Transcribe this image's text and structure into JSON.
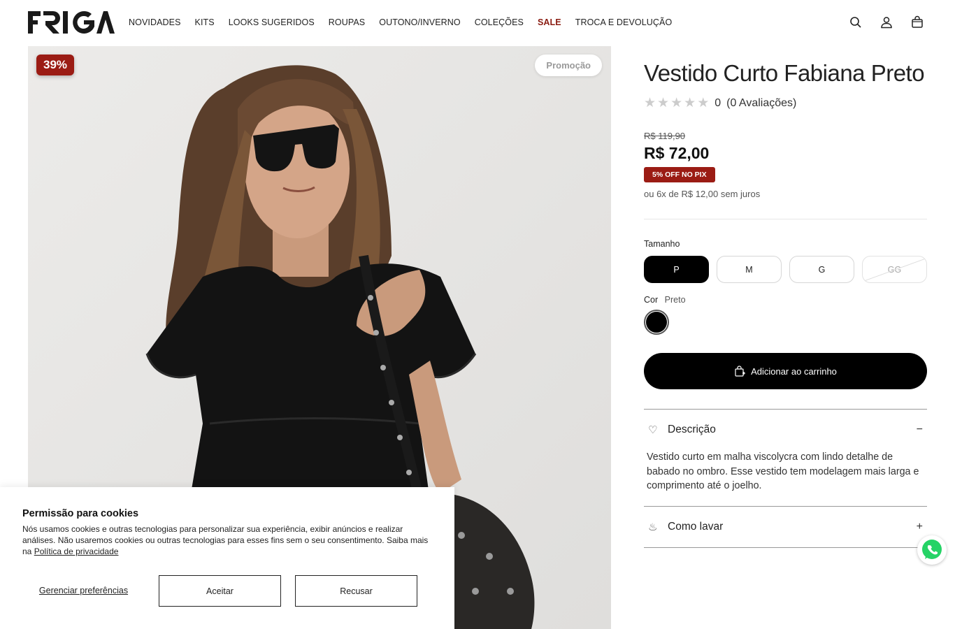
{
  "header": {
    "logo_text": "FRIGA",
    "nav": [
      {
        "label": "NOVIDADES"
      },
      {
        "label": "KITS"
      },
      {
        "label": "LOOKS SUGERIDOS"
      },
      {
        "label": "ROUPAS"
      },
      {
        "label": "OUTONO/INVERNO"
      },
      {
        "label": "COLEÇÕES"
      },
      {
        "label": "SALE"
      },
      {
        "label": "TROCA E DEVOLUÇÃO"
      }
    ],
    "icons": [
      "search-icon",
      "user-icon",
      "bag-icon"
    ],
    "sale_color": "#8a1c12"
  },
  "gallery": {
    "discount_badge": "39%",
    "promo_label": "Promoção",
    "badge_color": "#9b1c14"
  },
  "product": {
    "title": "Vestido Curto Fabiana Preto",
    "rating_value": "0",
    "rating_count": "(0 Avaliações)",
    "old_price": "R$ 119,90",
    "price": "R$ 72,00",
    "pix_badge": "5% OFF NO PIX",
    "installments": "ou 6x de R$ 12,00 sem juros",
    "size_label": "Tamanho",
    "sizes": [
      {
        "label": "P",
        "state": "selected"
      },
      {
        "label": "M",
        "state": "available"
      },
      {
        "label": "G",
        "state": "available"
      },
      {
        "label": "GG",
        "state": "unavailable"
      }
    ],
    "color_label": "Cor",
    "color_value": "Preto",
    "color_hex": "#000000",
    "add_to_cart": "Adicionar ao carrinho"
  },
  "accordion": {
    "description_title": "Descrição",
    "description_text": "Vestido curto em malha viscolycra com lindo detalhe de babado no ombro. Esse vestido tem modelagem mais larga e comprimento até o joelho.",
    "description_toggle": "−",
    "wash_title": "Como lavar",
    "wash_toggle": "+"
  },
  "cookies": {
    "title": "Permissão para cookies",
    "text": "Nós usamos cookies e outras tecnologias para personalizar sua experiência, exibir anúncios e realizar análises. Não usaremos cookies ou outras tecnologias para esses fins sem o seu consentimento. Saiba mais na",
    "policy_link": "Política de privacidade",
    "manage": "Gerenciar preferências",
    "accept": "Aceitar",
    "reject": "Recusar"
  }
}
